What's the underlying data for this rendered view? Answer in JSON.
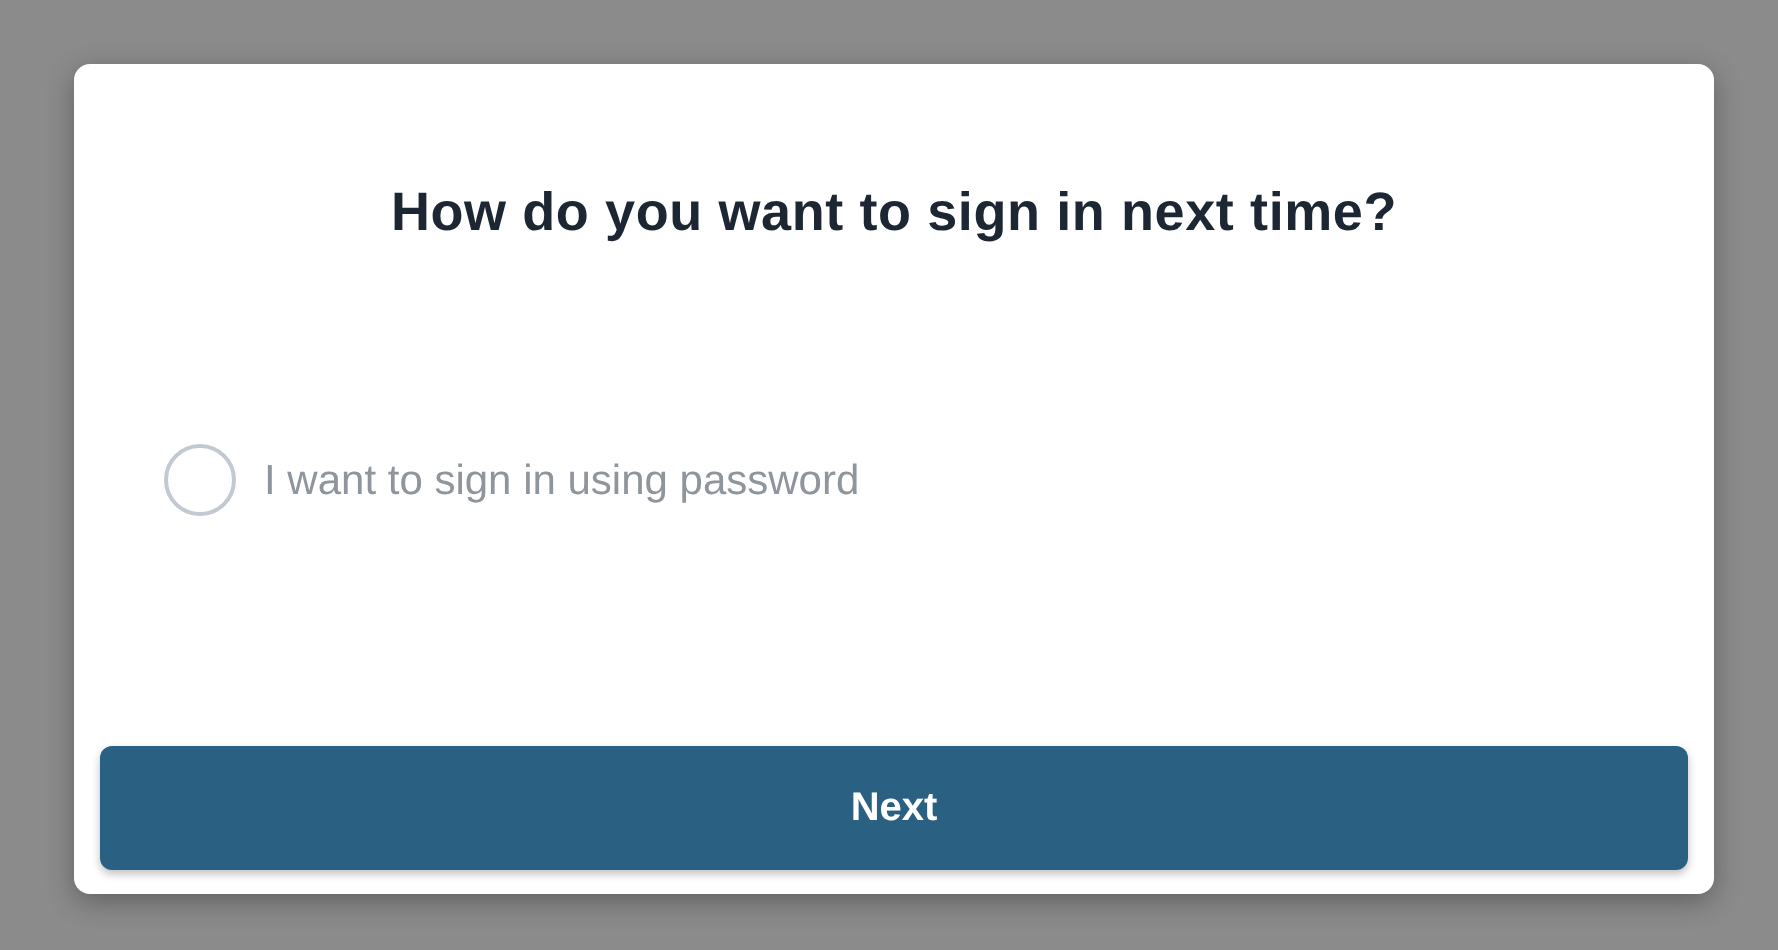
{
  "dialog": {
    "title": "How do you want to sign in next time?",
    "options": [
      {
        "label": "I want to sign in using password",
        "selected": false
      }
    ],
    "buttons": [
      "Next"
    ]
  }
}
